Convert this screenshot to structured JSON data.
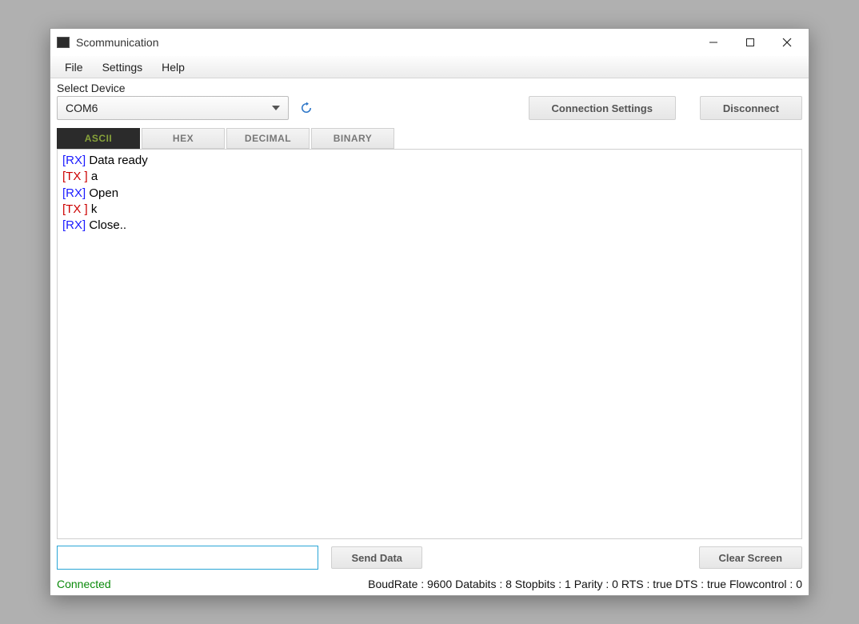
{
  "window": {
    "title": "Scommunication"
  },
  "menu": {
    "file": "File",
    "settings": "Settings",
    "help": "Help"
  },
  "device": {
    "label": "Select Device",
    "selected": "COM6"
  },
  "buttons": {
    "connection_settings": "Connection Settings",
    "disconnect": "Disconnect",
    "send_data": "Send Data",
    "clear_screen": "Clear Screen"
  },
  "tabs": {
    "ascii": "ASCII",
    "hex": "HEX",
    "decimal": "DECIMAL",
    "binary": "BINARY"
  },
  "log": [
    {
      "prefix": "[RX]",
      "type": "rx",
      "text": " Data ready"
    },
    {
      "prefix": "[TX ]",
      "type": "tx",
      "text": " a"
    },
    {
      "prefix": "[RX]",
      "type": "rx",
      "text": " Open"
    },
    {
      "prefix": "[TX ]",
      "type": "tx",
      "text": " k"
    },
    {
      "prefix": "[RX]",
      "type": "rx",
      "text": " Close.."
    }
  ],
  "input": {
    "value": ""
  },
  "status": {
    "connected": "Connected",
    "info": "BoudRate : 9600 Databits : 8 Stopbits : 1 Parity : 0 RTS : true DTS : true Flowcontrol : 0"
  }
}
